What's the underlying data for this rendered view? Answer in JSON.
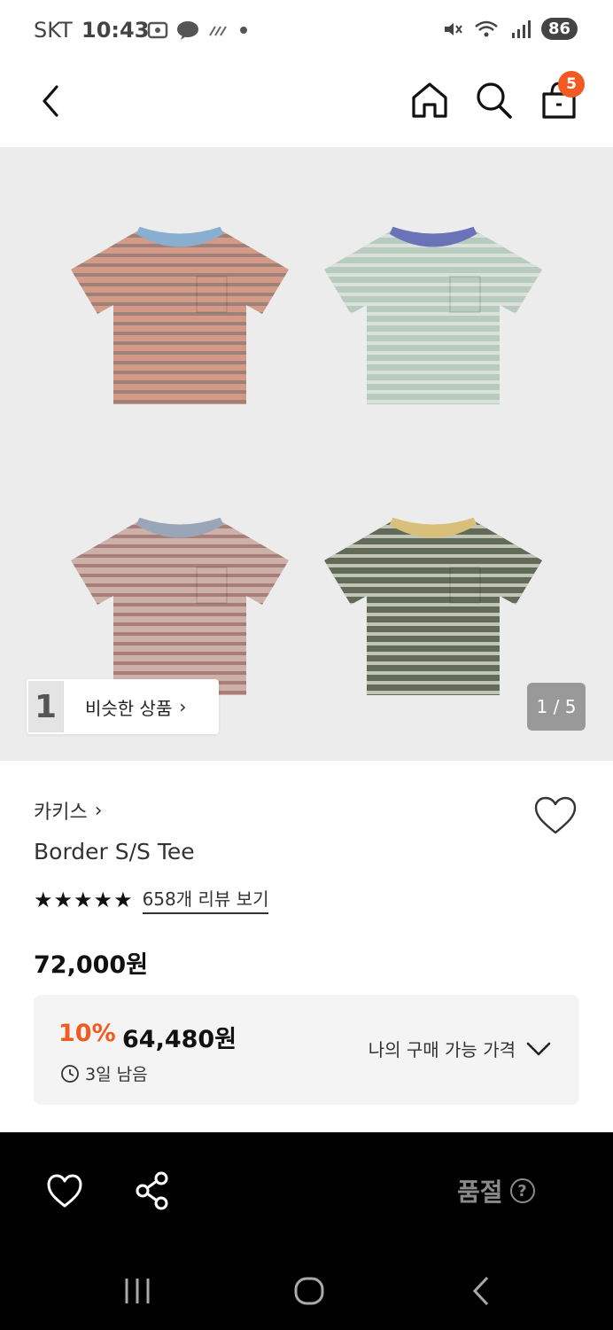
{
  "status_bar": {
    "carrier": "SKT",
    "time": "10:43",
    "battery": "86"
  },
  "header": {
    "cart_count": "5"
  },
  "gallery": {
    "similar_label": "비슷한 상품",
    "similar_thumb_text": "1",
    "page_indicator": "1 / 5",
    "shirt_colors": [
      "#d59a86",
      "#b7cbc0",
      "#cdb1a8",
      "#626a58"
    ],
    "collar_colors": [
      "#8aaed0",
      "#6a72b8",
      "#9aa6b8",
      "#d8c07a"
    ],
    "stripe_colors": [
      "#8a7a78",
      "#e6e8e2",
      "#9a6e6a",
      "#e0e4d8"
    ]
  },
  "product": {
    "brand": "카키스",
    "name": "Border S/S Tee",
    "stars": "★★★★★",
    "review_link": "658개 리뷰 보기",
    "price": "72,000원"
  },
  "discount": {
    "percent": "10%",
    "price": "64,480원",
    "timer": "3일 남음",
    "my_price_label": "나의 구매 가능 가격"
  },
  "bottom": {
    "soldout_label": "품절",
    "help_glyph": "?"
  }
}
